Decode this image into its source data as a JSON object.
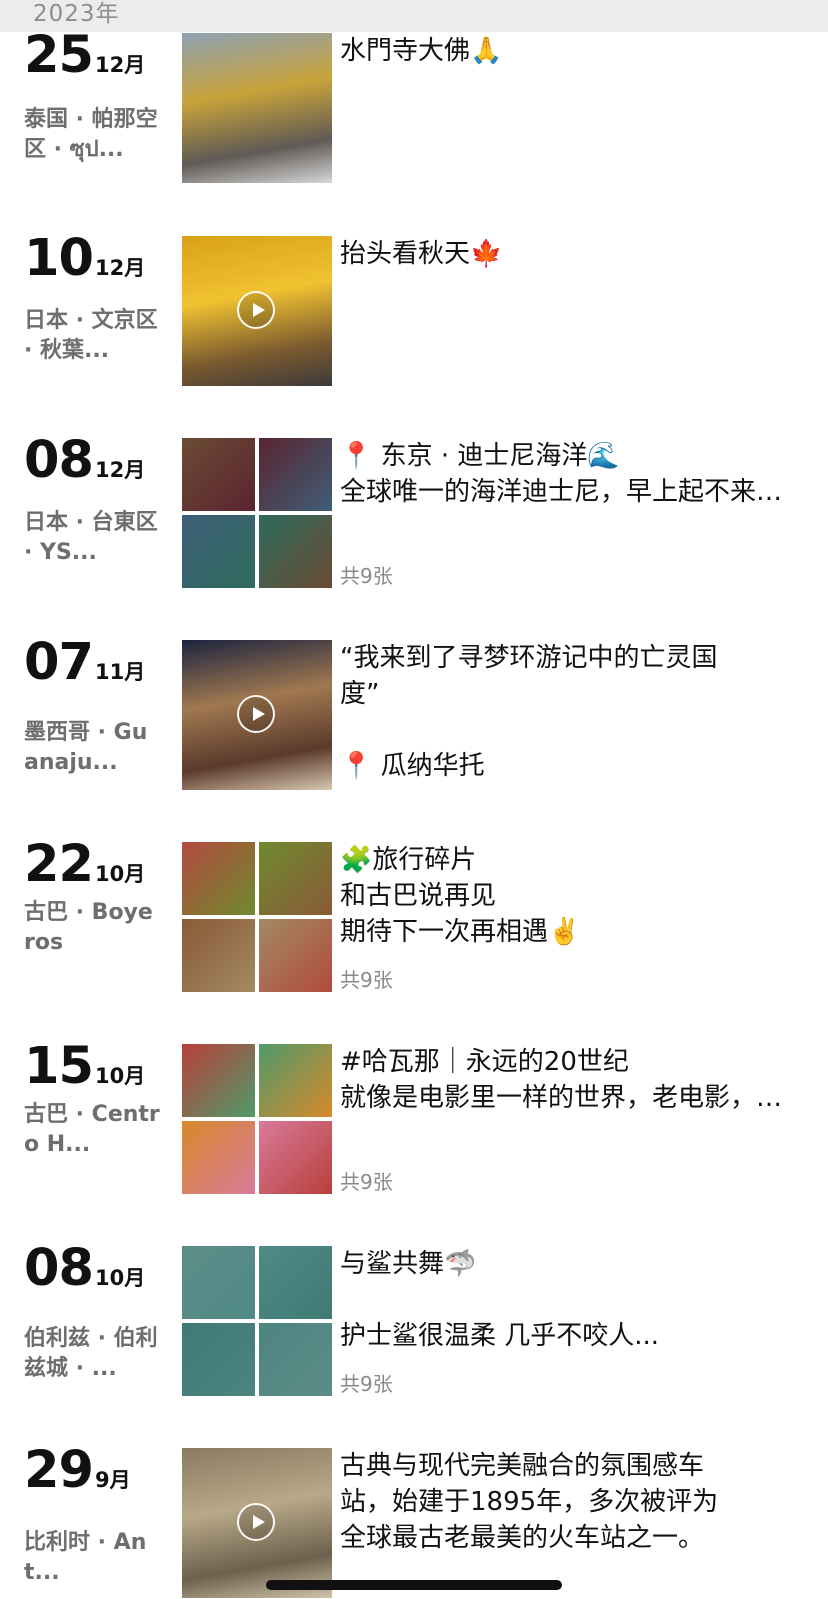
{
  "header": {
    "year": "2023年"
  },
  "entries": [
    {
      "day": "25",
      "month": "12月",
      "location": "泰国 · 帕那空区 · ซุป...",
      "text_lines": [
        "水門寺大佛🙏"
      ],
      "count": "",
      "media": "single-photo",
      "thumb_colors": [
        "#8da1b4",
        "#c9a33a",
        "#5f5a55",
        "#d8d8d8"
      ]
    },
    {
      "day": "10",
      "month": "12月",
      "location": "日本 · 文京区 · 秋葉...",
      "text_lines": [
        "抬头看秋天🍁"
      ],
      "count": "",
      "media": "video",
      "thumb_colors": [
        "#d9a11a",
        "#f0c230",
        "#7b5a2f",
        "#3d3a3a"
      ]
    },
    {
      "day": "08",
      "month": "12月",
      "location": "日本 · 台東区 · YS...",
      "text_lines": [
        "📍 东京 · 迪士尼海洋🌊",
        "全球唯一的海洋迪士尼，早上起不来，还走错馆去了陆地，导致太..."
      ],
      "count": "共9张",
      "media": "grid",
      "thumb_colors": [
        "#6b4b34",
        "#5a2430",
        "#3f5e78",
        "#2e6b5c"
      ]
    },
    {
      "day": "07",
      "month": "11月",
      "location": "墨西哥 · Guanaju...",
      "text_lines": [
        "“我来到了寻梦环游记中的亡灵国",
        "度”",
        "",
        "📍 瓜纳华托"
      ],
      "count": "",
      "media": "video",
      "thumb_colors": [
        "#1d2440",
        "#a07850",
        "#5b3a2c",
        "#d8c8b0"
      ]
    },
    {
      "day": "22",
      "month": "10月",
      "location": "古巴 · Boyeros",
      "text_lines": [
        "🧩旅行碎片",
        "和古巴说再见",
        "期待下一次再相遇✌️"
      ],
      "count": "共9张",
      "media": "grid",
      "thumb_colors": [
        "#b24a3f",
        "#6f8a2e",
        "#8a5a38",
        "#a28a62"
      ]
    },
    {
      "day": "15",
      "month": "10月",
      "location": "古巴 · Centro H...",
      "text_lines": [
        "#哈瓦那｜永远的20世纪",
        "就像是电影里一样的世界，老电影，老音像的情怀似乎被凝结在..."
      ],
      "count": "共9张",
      "media": "grid",
      "thumb_colors": [
        "#b8403a",
        "#4f9a6a",
        "#d7892a",
        "#d97a9a"
      ]
    },
    {
      "day": "08",
      "month": "10月",
      "location": "伯利兹 · 伯利兹城 · ...",
      "text_lines": [
        "与鲨共舞🦈",
        "",
        "护士鲨很温柔 几乎不咬人..."
      ],
      "count": "共9张",
      "media": "grid",
      "thumb_colors": [
        "#5d8c88",
        "#4f8a86",
        "#3f7a75",
        "#4c8580"
      ]
    },
    {
      "day": "29",
      "month": "9月",
      "location": "比利时 · Ant...",
      "text_lines": [
        "古典与现代完美融合的氛围感车",
        "站，始建于1895年，多次被评为",
        "全球最古老最美的火车站之一。"
      ],
      "count": "",
      "media": "video",
      "thumb_colors": [
        "#8a7a62",
        "#b8a988",
        "#6d604d",
        "#cfc3a8"
      ]
    }
  ]
}
